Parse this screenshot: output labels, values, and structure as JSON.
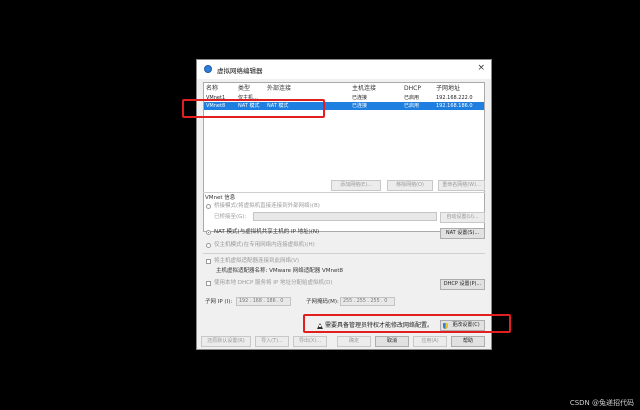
{
  "window": {
    "title": "虚拟网络编辑器",
    "close_glyph": "×"
  },
  "network_list": {
    "headers": [
      "名称",
      "类型",
      "外部连接",
      "主机连接",
      "DHCP",
      "子网地址"
    ],
    "rows": [
      [
        "VMnet1",
        "仅主机…",
        "",
        "已连接",
        "已启用",
        "192.168.222.0"
      ],
      [
        "VMnet8",
        "NAT 模式",
        "NAT 模式",
        "已连接",
        "已启用",
        "192.168.186.0"
      ]
    ]
  },
  "list_buttons": {
    "add": "添加网络(E)...",
    "remove": "移除网络(O)",
    "rename": "重命名网络(W)..."
  },
  "vmnet_info": {
    "group_label": "VMnet 信息",
    "bridged_label": "桥接模式(将虚拟机直接连接到外部网络)(B)",
    "bridged_to_label": "已桥接至(G):",
    "auto_settings_button": "自动设置(U)...",
    "nat_label": "NAT 模式(与虚拟机共享主机的 IP 地址)(N)",
    "nat_settings_button": "NAT 设置(S)...",
    "host_only_label": "仅主机模式(在专用网络内连接虚拟机)(H)",
    "connect_adapter_label": "将主机虚拟适配器连接到此网络(V)",
    "adapter_name_label": "主机虚拟适配器名称: VMware 网络适配器 VMnet8",
    "dhcp_label": "使用本地 DHCP 服务将 IP 地址分配给虚拟机(D)",
    "dhcp_settings_button": "DHCP 设置(P)...",
    "subnet_ip_label": "子网 IP (I):",
    "subnet_ip_value": "192 . 168 . 186 . 0",
    "subnet_mask_label": "子网掩码(M):",
    "subnet_mask_value": "255 . 255 . 255 . 0"
  },
  "admin_notice": {
    "text": "需要具备管理员特权才能修改网络配置。",
    "change_settings_button": "更改设置(C)"
  },
  "bottom_buttons": {
    "restore_defaults": "还原默认设置(R)",
    "import": "导入(T)...",
    "export": "导出(X)...",
    "ok": "确定",
    "cancel": "取消",
    "apply": "应用(A)",
    "help": "帮助"
  },
  "watermark": "CSDN @兔递招代码",
  "colors": {
    "selection": "#1e7fe0",
    "highlight_box": "#e02020",
    "background": "#000000"
  }
}
